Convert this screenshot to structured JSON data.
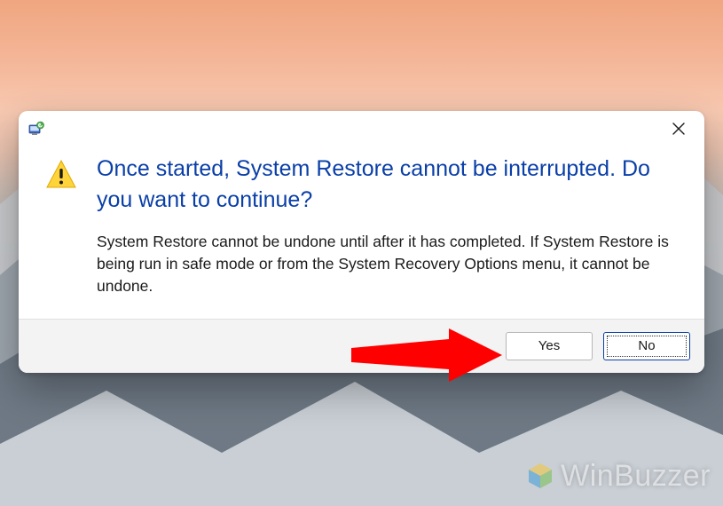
{
  "dialog": {
    "headline": "Once started, System Restore cannot be interrupted. Do you want to continue?",
    "body": "System Restore cannot be undone until after it has completed. If System Restore is being run in safe mode or from the System Recovery Options menu, it cannot be undone.",
    "yes_label": "Yes",
    "no_label": "No"
  },
  "watermark": {
    "text": "WinBuzzer"
  }
}
